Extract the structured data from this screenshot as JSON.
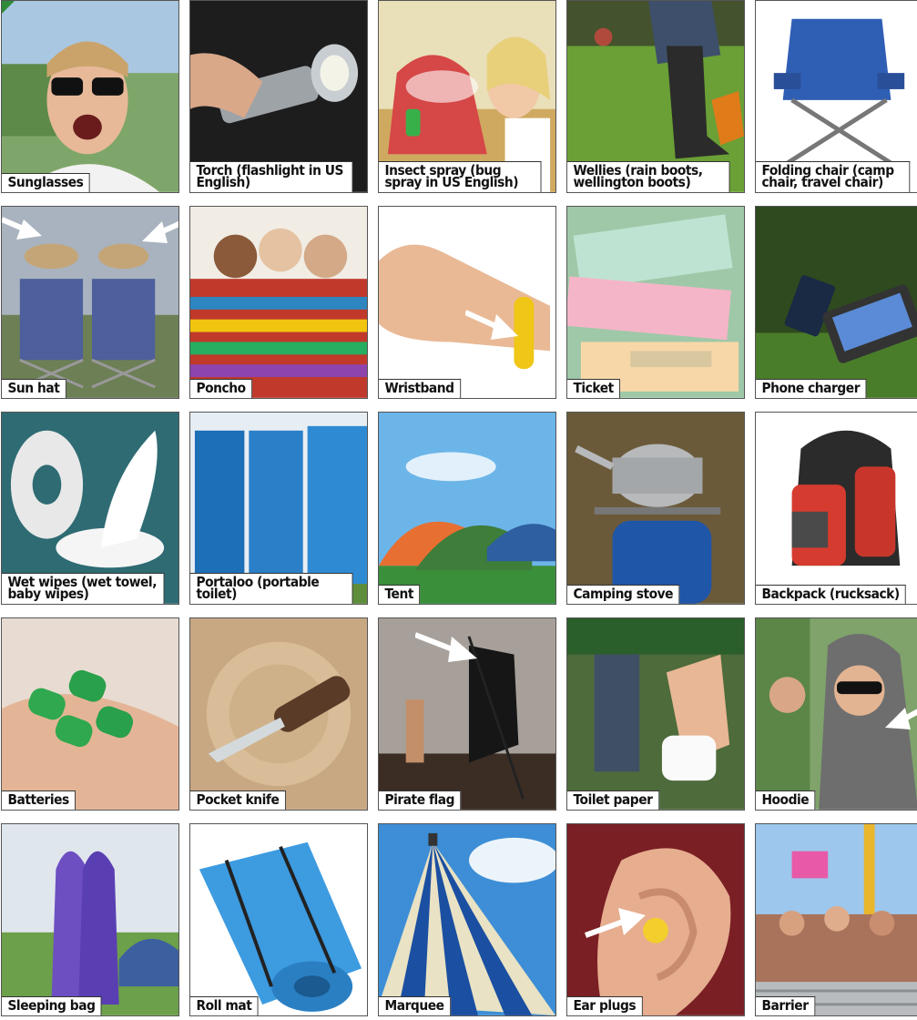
{
  "items": [
    {
      "label": "Sunglasses"
    },
    {
      "label": "Torch (flashlight in US English)"
    },
    {
      "label": "Insect spray (bug spray in US English)"
    },
    {
      "label": "Wellies (rain boots, wellington boots)"
    },
    {
      "label": "Folding chair (camp chair, travel chair)"
    },
    {
      "label": "Sun hat"
    },
    {
      "label": "Poncho"
    },
    {
      "label": "Wristband"
    },
    {
      "label": "Ticket"
    },
    {
      "label": "Phone charger"
    },
    {
      "label": "Wet wipes (wet towel, baby wipes)"
    },
    {
      "label": "Portaloo (portable toilet)"
    },
    {
      "label": "Tent"
    },
    {
      "label": "Camping stove"
    },
    {
      "label": "Backpack (rucksack)"
    },
    {
      "label": "Batteries"
    },
    {
      "label": "Pocket knife"
    },
    {
      "label": "Pirate flag"
    },
    {
      "label": "Toilet paper"
    },
    {
      "label": "Hoodie"
    },
    {
      "label": "Sleeping bag"
    },
    {
      "label": "Roll mat"
    },
    {
      "label": "Marquee"
    },
    {
      "label": "Ear plugs"
    },
    {
      "label": "Barrier"
    }
  ],
  "colors": {
    "accent": "#2e8b3a"
  }
}
